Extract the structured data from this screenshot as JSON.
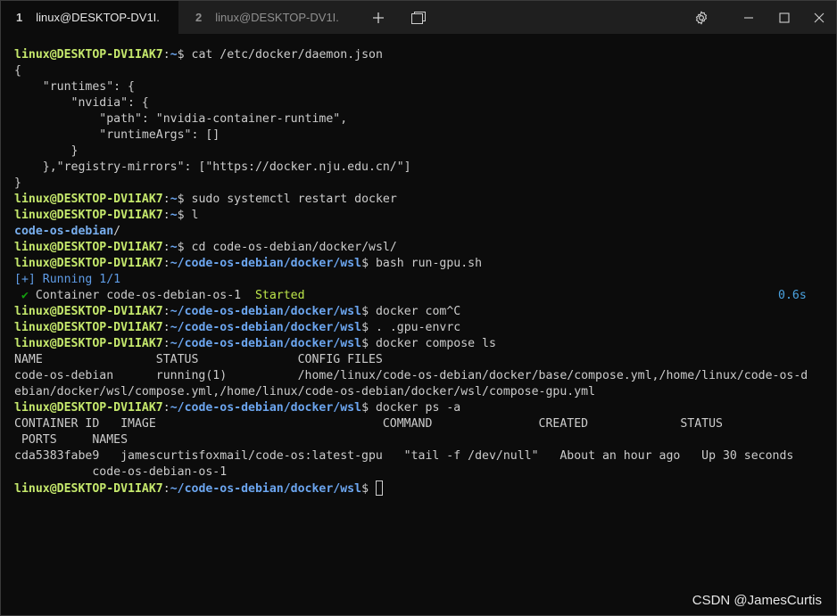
{
  "tabs": [
    {
      "number": "1",
      "title": "linux@DESKTOP-DV1I..."
    },
    {
      "number": "2",
      "title": "linux@DESKTOP-DV1I..."
    }
  ],
  "prompt": {
    "user": "linux@DESKTOP-DV1IAK7",
    "home": "~",
    "wsl_path": "~/code-os-debian/docker/wsl",
    "symbol": "$"
  },
  "lines": {
    "cmd_cat": " cat /etc/docker/daemon.json",
    "json1": "{",
    "json2": "    \"runtimes\": {",
    "json3": "        \"nvidia\": {",
    "json4": "            \"path\": \"nvidia-container-runtime\",",
    "json5": "            \"runtimeArgs\": []",
    "json6": "        }",
    "json7": "    },\"registry-mirrors\": [\"https://docker.nju.edu.cn/\"]",
    "json8": "}",
    "cmd_restart": " sudo systemctl restart docker",
    "cmd_l": " l",
    "ls_out": "code-os-debian",
    "ls_slash": "/",
    "cmd_cd": " cd code-os-debian/docker/wsl/",
    "cmd_bash": " bash run-gpu.sh",
    "running": "[+] Running 1/1",
    "check": " ✔",
    "container_msg": " Container code-os-debian-os-1  ",
    "started": "Started",
    "elapsed": "0.6s",
    "cmd_com": " docker com^C",
    "cmd_envrc": " . .gpu-envrc",
    "cmd_compose_ls": " docker compose ls",
    "ls_header": "NAME                STATUS              CONFIG FILES",
    "ls_row1": "code-os-debian      running(1)          /home/linux/code-os-debian/docker/base/compose.yml,/home/linux/code-os-d",
    "ls_row2": "ebian/docker/wsl/compose.yml,/home/linux/code-os-debian/docker/wsl/compose-gpu.yml",
    "cmd_ps": " docker ps -a",
    "ps_header1": "CONTAINER ID   IMAGE                                COMMAND               CREATED             STATUS",
    "ps_header2": " PORTS     NAMES",
    "ps_row1": "cda5383fabe9   jamescurtisfoxmail/code-os:latest-gpu   \"tail -f /dev/null\"   About an hour ago   Up 30 seconds",
    "ps_row2": "           code-os-debian-os-1"
  },
  "watermark": "CSDN @JamesCurtis"
}
